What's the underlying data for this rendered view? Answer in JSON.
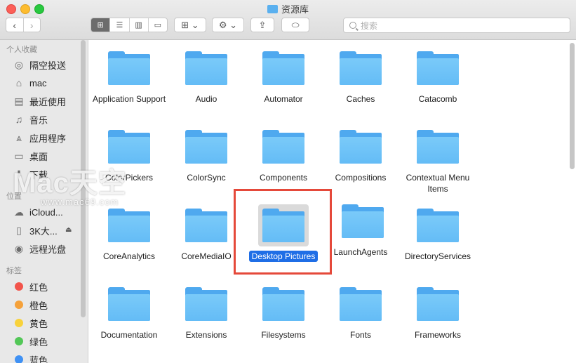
{
  "window": {
    "title": "资源库"
  },
  "search": {
    "placeholder": "搜索"
  },
  "sidebar": {
    "favorites_title": "个人收藏",
    "favorites": [
      {
        "label": "隔空投送",
        "icon": "airdrop-icon"
      },
      {
        "label": "mac",
        "icon": "home-icon"
      },
      {
        "label": "最近使用",
        "icon": "recents-icon"
      },
      {
        "label": "音乐",
        "icon": "music-icon"
      },
      {
        "label": "应用程序",
        "icon": "applications-icon"
      },
      {
        "label": "桌面",
        "icon": "desktop-icon"
      },
      {
        "label": "下载",
        "icon": "downloads-icon"
      }
    ],
    "locations_title": "位置",
    "locations": [
      {
        "label": "iCloud...",
        "icon": "cloud-icon"
      },
      {
        "label": "3K大...",
        "icon": "disk-icon"
      },
      {
        "label": "远程光盘",
        "icon": "optical-disc-icon"
      }
    ],
    "tags_title": "标签",
    "tags": [
      {
        "label": "红色",
        "color": "#f2544b"
      },
      {
        "label": "橙色",
        "color": "#f5a13a"
      },
      {
        "label": "黄色",
        "color": "#f8d23b"
      },
      {
        "label": "绿色",
        "color": "#52c757"
      },
      {
        "label": "蓝色",
        "color": "#3f91f4"
      }
    ]
  },
  "folders": [
    {
      "label": "Application Support"
    },
    {
      "label": "Audio"
    },
    {
      "label": "Automator"
    },
    {
      "label": "Caches"
    },
    {
      "label": "Catacomb"
    },
    {
      "label": "ColorPickers"
    },
    {
      "label": "ColorSync"
    },
    {
      "label": "Components"
    },
    {
      "label": "Compositions"
    },
    {
      "label": "Contextual Menu Items"
    },
    {
      "label": "CoreAnalytics"
    },
    {
      "label": "CoreMediaIO"
    },
    {
      "label": "Desktop Pictures"
    },
    {
      "label": "LaunchAgents"
    },
    {
      "label": "DirectoryServices"
    },
    {
      "label": "Documentation"
    },
    {
      "label": "Extensions"
    },
    {
      "label": "Filesystems"
    },
    {
      "label": "Fonts"
    },
    {
      "label": "Frameworks"
    }
  ],
  "selected_folder": "Desktop Pictures",
  "watermark": {
    "text": "Mac天空",
    "url": "www.mac69.com"
  }
}
